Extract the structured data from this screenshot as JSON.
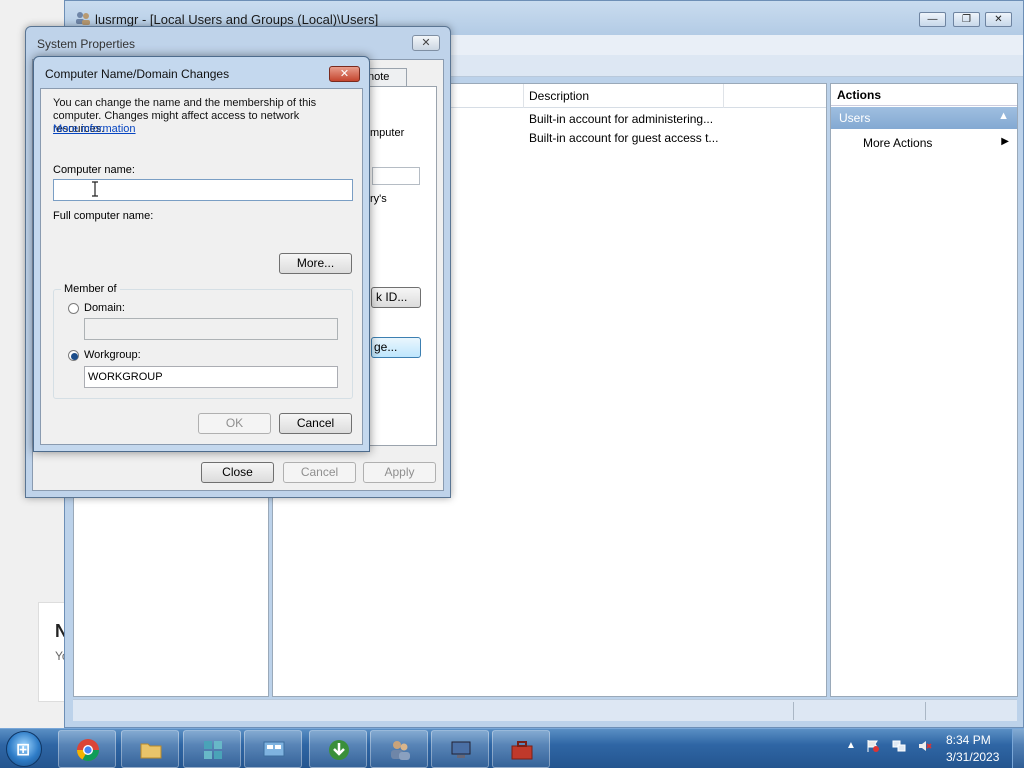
{
  "main_window": {
    "title": "lusrmgr - [Local Users and Groups (Local)\\Users]",
    "minimize": "—",
    "restore": "❐",
    "close": "✕"
  },
  "list": {
    "header_description": "Description",
    "rows": [
      {
        "description": "Built-in account for administering..."
      },
      {
        "description": "Built-in account for guest access t..."
      }
    ]
  },
  "actions": {
    "title": "Actions",
    "section": "Users",
    "more_actions": "More Actions"
  },
  "system_properties": {
    "title": "System Properties",
    "close": "✕",
    "visible_tab_fragment": "note",
    "text_fragment_1": "mputer",
    "text_fragment_2": "ry's",
    "network_id_fragment": "k ID...",
    "change_fragment": "ge...",
    "buttons": {
      "close": "Close",
      "cancel": "Cancel",
      "apply": "Apply"
    }
  },
  "computer_name_dialog": {
    "title": "Computer Name/Domain Changes",
    "close": "✕",
    "info_text": "You can change the name and the membership of this computer. Changes might affect access to network resources.",
    "more_info_link": "More information",
    "computer_name_label": "Computer name:",
    "computer_name_value": "",
    "full_computer_name_label": "Full computer name:",
    "more_button": "More...",
    "member_of_label": "Member of",
    "domain_label": "Domain:",
    "domain_value": "",
    "workgroup_label": "Workgroup:",
    "workgroup_value": "WORKGROUP",
    "selected_membership": "workgroup",
    "ok_button": "OK",
    "cancel_button": "Cancel"
  },
  "taskbar": {
    "start_glyph": "⊞",
    "items": [
      {
        "name": "chrome-icon",
        "color": "#e8453c"
      },
      {
        "name": "file-explorer-icon",
        "color": "#e9c46a"
      },
      {
        "name": "registry-editor-icon",
        "color": "#4aa3b8"
      },
      {
        "name": "control-panel-icon",
        "color": "#7fb3e0"
      },
      {
        "name": "internet-download-manager-icon",
        "color": "#3a8f3a"
      },
      {
        "name": "users-management-icon",
        "color": "#c9a37a"
      },
      {
        "name": "computer-management-icon",
        "color": "#4a6fa5"
      },
      {
        "name": "toolbox-icon",
        "color": "#c0392b"
      }
    ],
    "tray_arrow": "▲",
    "time": "8:34 PM",
    "date": "3/31/2023"
  },
  "background_card": {
    "big_text": "N",
    "small_text": "Yo"
  },
  "colors": {
    "title_close_red": "#c4452e",
    "link_blue": "#0645c1",
    "taskbar_blue": "#2f66a5"
  }
}
